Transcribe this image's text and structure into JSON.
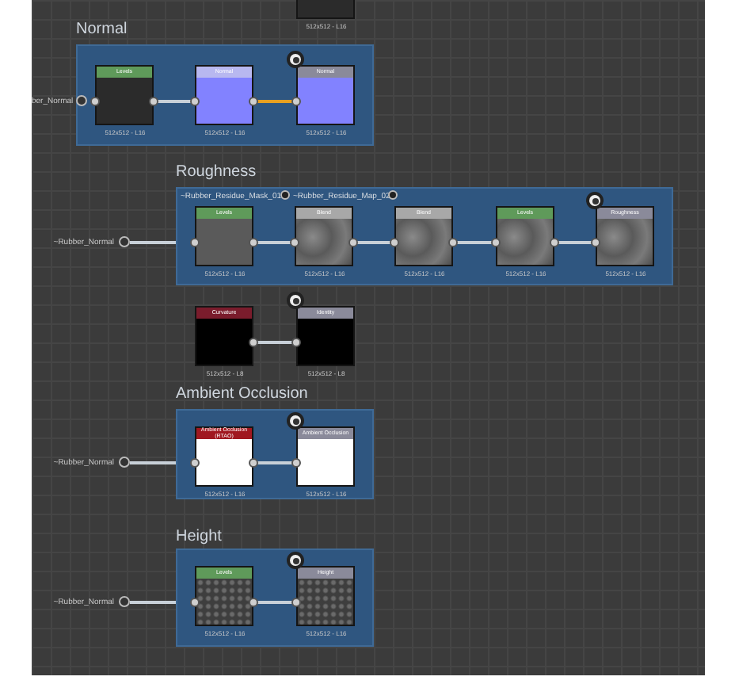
{
  "groups": [
    {
      "kind": "partial",
      "nodes": [
        {
          "footer": "512x512 - L16",
          "kind": "dark",
          "output": false
        }
      ]
    },
    {
      "kind": "frame",
      "title": "Normal",
      "input": "ber_Normal",
      "nodes": [
        {
          "title": "Levels",
          "footer": "512x512 - L16",
          "color": "#5f9a5a",
          "kind": "dark",
          "output": false
        },
        {
          "title": "Normal",
          "footer": "512x512 - L16",
          "color": "#b8b8f0",
          "kind": "purple",
          "output": false
        },
        {
          "title": "Normal",
          "footer": "512x512 - L16",
          "color": "#8a8a9a",
          "kind": "purple",
          "output": true
        }
      ],
      "links": [
        {
          "color": "#c8d0d8"
        },
        {
          "color": "#e8a020"
        }
      ]
    },
    {
      "kind": "frame",
      "title": "Roughness",
      "input": "~Rubber_Normal",
      "extra_inputs": [
        "~Rubber_Residue_Mask_01",
        "~Rubber_Residue_Map_02"
      ],
      "nodes": [
        {
          "title": "Levels",
          "footer": "512x512 - L16",
          "color": "#5f9a5a",
          "kind": "gray",
          "output": false
        },
        {
          "title": "Blend",
          "footer": "512x512 - L16",
          "color": "#a8a8a8",
          "kind": "noise",
          "output": false
        },
        {
          "title": "Blend",
          "footer": "512x512 - L16",
          "color": "#a8a8a8",
          "kind": "noise",
          "output": false
        },
        {
          "title": "Levels",
          "footer": "512x512 - L16",
          "color": "#5f9a5a",
          "kind": "noise",
          "output": false
        },
        {
          "title": "Roughness",
          "footer": "512x512 - L16",
          "color": "#8a8a9a",
          "kind": "noise",
          "output": true
        }
      ],
      "links": [
        {
          "color": "#c8d0d8"
        },
        {
          "color": "#c8d0d8"
        },
        {
          "color": "#c8d0d8"
        },
        {
          "color": "#c8d0d8"
        }
      ]
    },
    {
      "kind": "loose",
      "nodes": [
        {
          "title": "Curvature",
          "footer": "512x512 - L8",
          "color": "#7a1c2c",
          "kind": "black",
          "output": false
        },
        {
          "title": "Identity",
          "footer": "512x512 - L8",
          "color": "#8a8a9a",
          "kind": "black",
          "output": true
        }
      ],
      "links": [
        {
          "color": "#c8d0d8"
        }
      ]
    },
    {
      "kind": "frame",
      "title": "Ambient Occlusion",
      "input": "~Rubber_Normal",
      "nodes": [
        {
          "title": "Ambient Occlusion (RTAO)",
          "footer": "512x512 - L16",
          "color": "#a01820",
          "kind": "white",
          "output": false
        },
        {
          "title": "Ambient Occlusion",
          "footer": "512x512 - L16",
          "color": "#8a8a9a",
          "kind": "white",
          "output": true
        }
      ],
      "links": [
        {
          "color": "#c8d0d8"
        }
      ]
    },
    {
      "kind": "frame",
      "title": "Height",
      "input": "~Rubber_Normal",
      "nodes": [
        {
          "title": "Levels",
          "footer": "512x512 - L16",
          "color": "#5f9a5a",
          "kind": "tiles",
          "output": false
        },
        {
          "title": "Height",
          "footer": "512x512 - L16",
          "color": "#8a8a9a",
          "kind": "tiles",
          "output": true
        }
      ],
      "links": [
        {
          "color": "#c8d0d8"
        }
      ]
    }
  ]
}
